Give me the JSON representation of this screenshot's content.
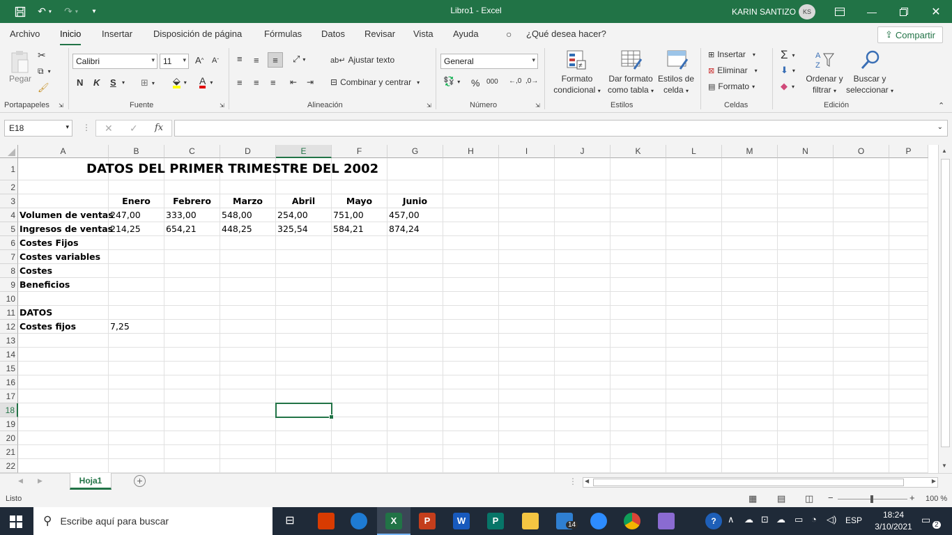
{
  "window": {
    "title": "Libro1  -  Excel",
    "user": "KARIN SANTIZO",
    "initials": "KS"
  },
  "menu": {
    "tabs": [
      "Archivo",
      "Inicio",
      "Insertar",
      "Disposición de página",
      "Fórmulas",
      "Datos",
      "Revisar",
      "Vista",
      "Ayuda"
    ],
    "tell_me": "¿Qué desea hacer?",
    "share": "Compartir"
  },
  "ribbon": {
    "groups": {
      "clipboard": "Portapapeles",
      "font": "Fuente",
      "alignment": "Alineación",
      "number": "Número",
      "styles": "Estilos",
      "cells": "Celdas",
      "editing": "Edición"
    },
    "paste": "Pegar",
    "font_name": "Calibri",
    "font_size": "11",
    "bold": "N",
    "italic": "K",
    "underline": "S",
    "wrap_text": "Ajustar texto",
    "merge_center": "Combinar y centrar",
    "number_format": "General",
    "percent": "%",
    "thousands": "000",
    "cond_format": [
      "Formato",
      "condicional"
    ],
    "format_table": [
      "Dar formato",
      "como tabla"
    ],
    "cell_styles": [
      "Estilos de",
      "celda"
    ],
    "insert": "Insertar",
    "delete": "Eliminar",
    "format": "Formato",
    "sort_filter": [
      "Ordenar y",
      "filtrar"
    ],
    "find_select": [
      "Buscar y",
      "seleccionar"
    ]
  },
  "formula_bar": {
    "name_box": "E18",
    "fx": "fx",
    "formula": ""
  },
  "columns": [
    "A",
    "B",
    "C",
    "D",
    "E",
    "F",
    "G",
    "H",
    "I",
    "J",
    "K",
    "L",
    "M",
    "N",
    "O",
    "P"
  ],
  "rows": [
    "1",
    "2",
    "3",
    "4",
    "5",
    "6",
    "7",
    "8",
    "9",
    "10",
    "11",
    "12",
    "13",
    "14",
    "15",
    "16",
    "17",
    "18",
    "19",
    "20",
    "21",
    "22"
  ],
  "selected": {
    "column": "E",
    "row": "18"
  },
  "cells": {
    "A1": "DATOS DEL PRIMER TRIMESTRE DEL 2002",
    "B3": "Enero",
    "C3": "Febrero",
    "D3": "Marzo",
    "E3": "Abril",
    "F3": "Mayo",
    "G3": "Junio",
    "A4": "Volumen de ventas",
    "B4": "247,00",
    "C4": "333,00",
    "D4": "548,00",
    "E4": "254,00",
    "F4": "751,00",
    "G4": "457,00",
    "A5": "Ingresos de ventas",
    "B5": "214,25",
    "C5": "654,21",
    "D5": "448,25",
    "E5": "325,54",
    "F5": "584,21",
    "G5": "874,24",
    "A6": "Costes Fijos",
    "A7": "Costes variables",
    "A8": "Costes",
    "A9": "Beneficios",
    "A11": "DATOS",
    "A12": "Costes fijos",
    "B12": "7,25"
  },
  "sheet": {
    "tab": "Hoja1"
  },
  "status": {
    "mode": "Listo",
    "zoom": "100 %"
  },
  "taskbar": {
    "search_placeholder": "Escribe aquí para buscar",
    "lang": "ESP",
    "time": "18:24",
    "date": "3/10/2021",
    "mail_badge": "14",
    "notif_count": "2"
  }
}
